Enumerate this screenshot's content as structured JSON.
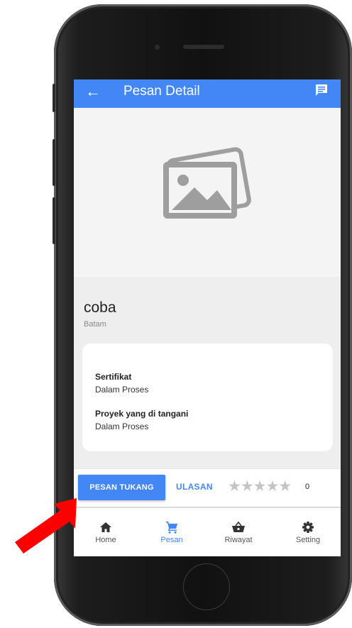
{
  "appbar": {
    "title": "Pesan Detail",
    "back_icon": "arrow-left-icon",
    "chat_icon": "chat-icon"
  },
  "hero": {
    "image_icon": "image-placeholder-icon"
  },
  "profile": {
    "name": "coba",
    "city": "Batam"
  },
  "details": [
    {
      "label": "Sertifikat",
      "value": "Dalam Proses"
    },
    {
      "label": "Proyek yang di tangani",
      "value": "Dalam Proses"
    }
  ],
  "actions": {
    "pesan_label": "PESAN TUKANG",
    "ulasan_label": "ULASAN",
    "stars": "★★★★★",
    "rating_count": "0",
    "rating_filled": 0,
    "rating_max": 5
  },
  "nav": [
    {
      "label": "Home",
      "icon": "home-icon",
      "active": false
    },
    {
      "label": "Pesan",
      "icon": "cart-icon",
      "active": true
    },
    {
      "label": "Riwayat",
      "icon": "basket-icon",
      "active": false
    },
    {
      "label": "Setting",
      "icon": "gear-icon",
      "active": false
    }
  ],
  "colors": {
    "accent": "#4287f5",
    "arrow": "#ff0000",
    "star_empty": "#c4c4c4"
  }
}
